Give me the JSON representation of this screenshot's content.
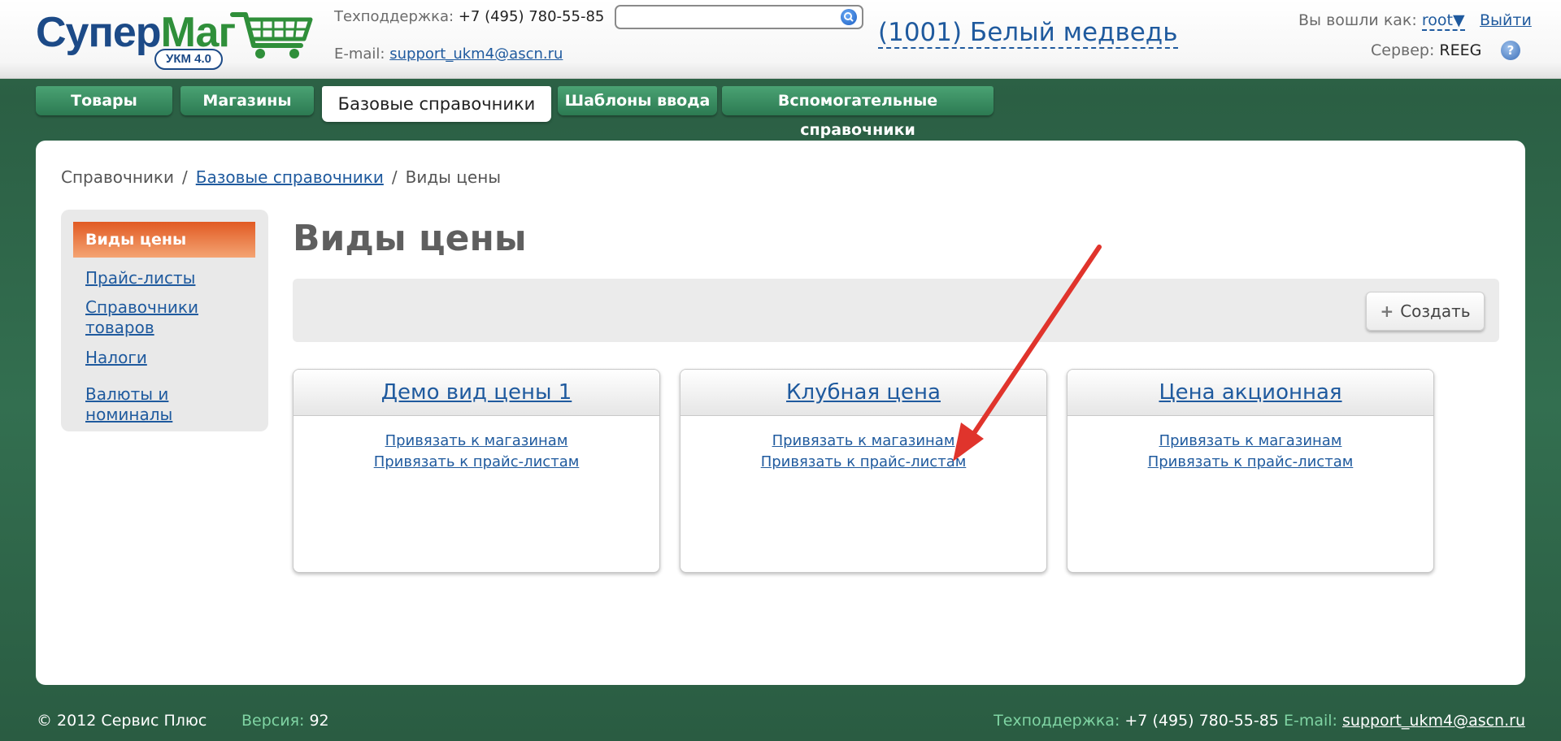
{
  "logo": {
    "brand_first": "Супер",
    "brand_second": "Маг",
    "badge": "УКМ 4.0"
  },
  "header": {
    "support_label": "Техподдержка:",
    "support_phone": "+7 (495) 780-55-85",
    "email_label": "E-mail:",
    "email": "support_ukm4@ascn.ru",
    "search_placeholder": "",
    "organization": "(1001) Белый медведь",
    "login_label": "Вы вошли как:",
    "user": "root",
    "user_caret": "▼",
    "logout": "Выйти",
    "server_label": "Сервер:",
    "server": "REEG",
    "help": "?"
  },
  "tabs": [
    {
      "label": "Товары",
      "active": false
    },
    {
      "label": "Магазины",
      "active": false
    },
    {
      "label": "Базовые справочники",
      "active": true
    },
    {
      "label": "Шаблоны ввода",
      "active": false
    },
    {
      "label": "Вспомогательные справочники",
      "active": false
    }
  ],
  "breadcrumb": {
    "root": "Справочники",
    "sep1": "/",
    "parent": "Базовые справочники",
    "sep2": "/",
    "current": "Виды цены"
  },
  "sidebar": {
    "active": "Виды цены",
    "items": [
      "Прайс-листы",
      "Справочники товаров",
      "Налоги",
      "Валюты и номиналы"
    ]
  },
  "page_title": "Виды цены",
  "toolbar": {
    "create_icon": "+",
    "create_label": "Создать"
  },
  "cards": [
    {
      "title": "Демо вид цены 1",
      "link_shops": "Привязать к магазинам",
      "link_pricelists": "Привязать к прайс-листам"
    },
    {
      "title": "Клубная цена",
      "link_shops": "Привязать к магазинам",
      "link_pricelists": "Привязать к прайс-листам"
    },
    {
      "title": "Цена акционная",
      "link_shops": "Привязать к магазинам",
      "link_pricelists": "Привязать к прайс-листам"
    }
  ],
  "footer": {
    "copyright": "© 2012 Сервис Плюс",
    "version_label": "Версия:",
    "version": "92",
    "support_label": "Техподдержка:",
    "support_phone": "+7 (495) 780-55-85",
    "email_label": "E-mail:",
    "email": "support_ukm4@ascn.ru"
  },
  "colors": {
    "brand_blue": "#1c4a87",
    "brand_green": "#2f8f3a",
    "tab_green": "#3a8f62",
    "active_orange": "#e15a23",
    "annotation_red": "#e0342c"
  }
}
